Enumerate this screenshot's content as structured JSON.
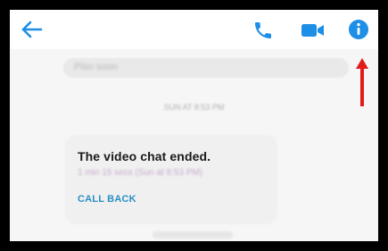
{
  "colors": {
    "accent": "#1d8fe6",
    "annotation": "#e21b1b",
    "card_button": "#2a8fc4"
  },
  "toolbar": {
    "back_icon": "back-arrow-icon",
    "call_icon": "phone-icon",
    "video_icon": "video-camera-icon",
    "info_icon": "info-icon"
  },
  "chat": {
    "previous_message": "Plan soon",
    "timestamp": "SUN AT 8:53 PM",
    "call_card": {
      "title": "The video chat ended.",
      "subtitle": "1 min 15 secs (Sun at 8:53 PM)",
      "button_label": "CALL BACK"
    }
  },
  "annotation": {
    "icon": "red-up-arrow-icon"
  }
}
